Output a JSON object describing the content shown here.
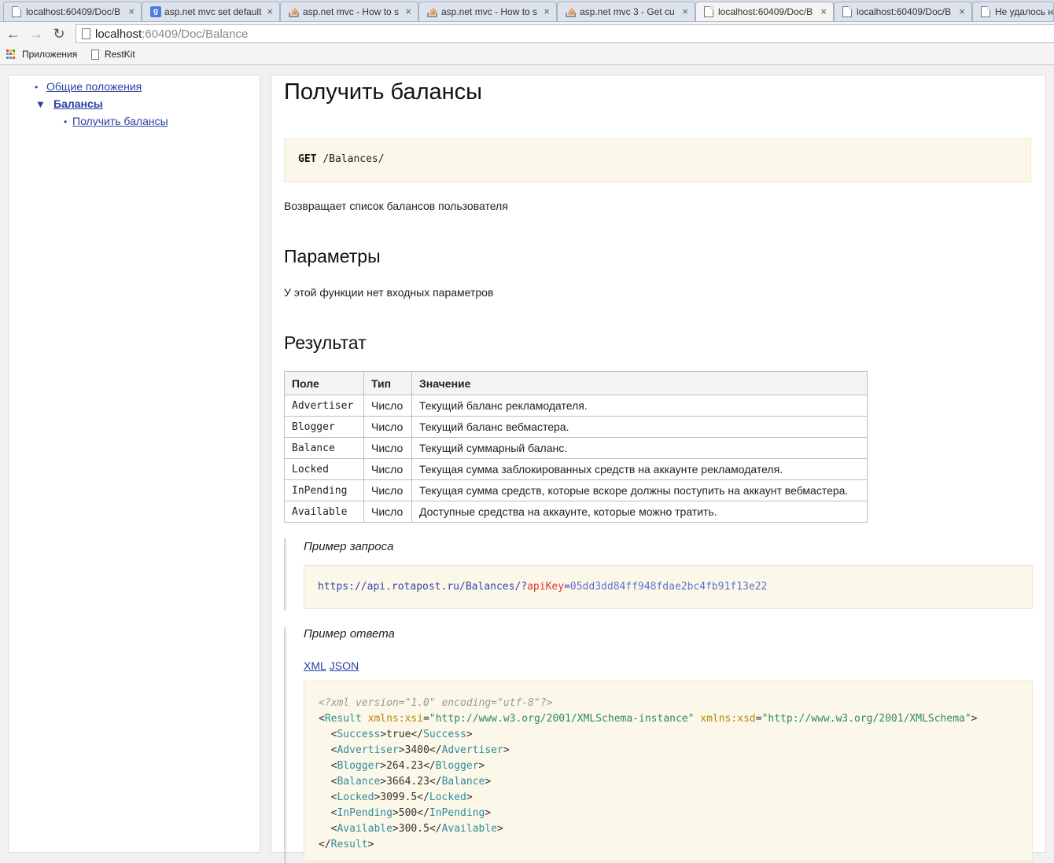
{
  "browser": {
    "tabs": [
      {
        "title": "localhost:60409/Doc/B",
        "icon": "doc"
      },
      {
        "title": "asp.net mvc set default",
        "icon": "google"
      },
      {
        "title": "asp.net mvc - How to s",
        "icon": "stackoverflow"
      },
      {
        "title": "asp.net mvc - How to s",
        "icon": "stackoverflow"
      },
      {
        "title": "asp.net mvc 3 - Get cu",
        "icon": "stackoverflow"
      },
      {
        "title": "localhost:60409/Doc/B",
        "icon": "doc"
      },
      {
        "title": "localhost:60409/Doc/B",
        "icon": "doc"
      },
      {
        "title": "Не удалось на",
        "icon": "doc"
      }
    ],
    "url_host": "localhost",
    "url_path": ":60409/Doc/Balance",
    "bookmarks": {
      "apps": "Приложения",
      "restkit": "RestKit"
    }
  },
  "sidebar": {
    "items": [
      {
        "label": "Общие положения"
      },
      {
        "label": "Балансы"
      },
      {
        "label": "Получить балансы"
      }
    ]
  },
  "page": {
    "title": "Получить балансы",
    "method": "GET",
    "endpoint": "/Balances/",
    "description": "Возвращает список балансов пользователя",
    "params_heading": "Параметры",
    "params_text": "У этой функции нет входных параметров",
    "result_heading": "Результат",
    "table": {
      "headers": [
        "Поле",
        "Тип",
        "Значение"
      ],
      "rows": [
        [
          "Advertiser",
          "Число",
          "Текущий баланс рекламодателя."
        ],
        [
          "Blogger",
          "Число",
          "Текущий баланс вебмастера."
        ],
        [
          "Balance",
          "Число",
          "Текущий суммарный баланс."
        ],
        [
          "Locked",
          "Число",
          "Текущая сумма заблокированных средств на аккаунте рекламодателя."
        ],
        [
          "InPending",
          "Число",
          "Текущая сумма средств, которые вскоре должны поступить на аккаунт вебмастера."
        ],
        [
          "Available",
          "Число",
          "Доступные средства на аккаунте, которые можно тратить."
        ]
      ]
    },
    "request_example": {
      "caption": "Пример запроса",
      "url": "https://api.rotapost.ru/Balances/",
      "q": "?",
      "key": "apiKey",
      "eq": "=",
      "value": "05dd3dd84ff948fdae2bc4fb91f13e22"
    },
    "response_example": {
      "caption": "Пример ответа",
      "formats": [
        "XML",
        "JSON"
      ],
      "xml_decl": "<?xml version=\"1.0\" encoding=\"utf-8\"?>",
      "root": "Result",
      "xsi_attr": "xmlns:xsi",
      "xsi_val": "\"http://www.w3.org/2001/XMLSchema-instance\"",
      "xsd_attr": "xmlns:xsd",
      "xsd_val": "\"http://www.w3.org/2001/XMLSchema\"",
      "fields": [
        {
          "tag": "Success",
          "value": "true"
        },
        {
          "tag": "Advertiser",
          "value": "3400"
        },
        {
          "tag": "Blogger",
          "value": "264.23"
        },
        {
          "tag": "Balance",
          "value": "3664.23"
        },
        {
          "tag": "Locked",
          "value": "3099.5"
        },
        {
          "tag": "InPending",
          "value": "500"
        },
        {
          "tag": "Available",
          "value": "300.5"
        }
      ]
    }
  }
}
